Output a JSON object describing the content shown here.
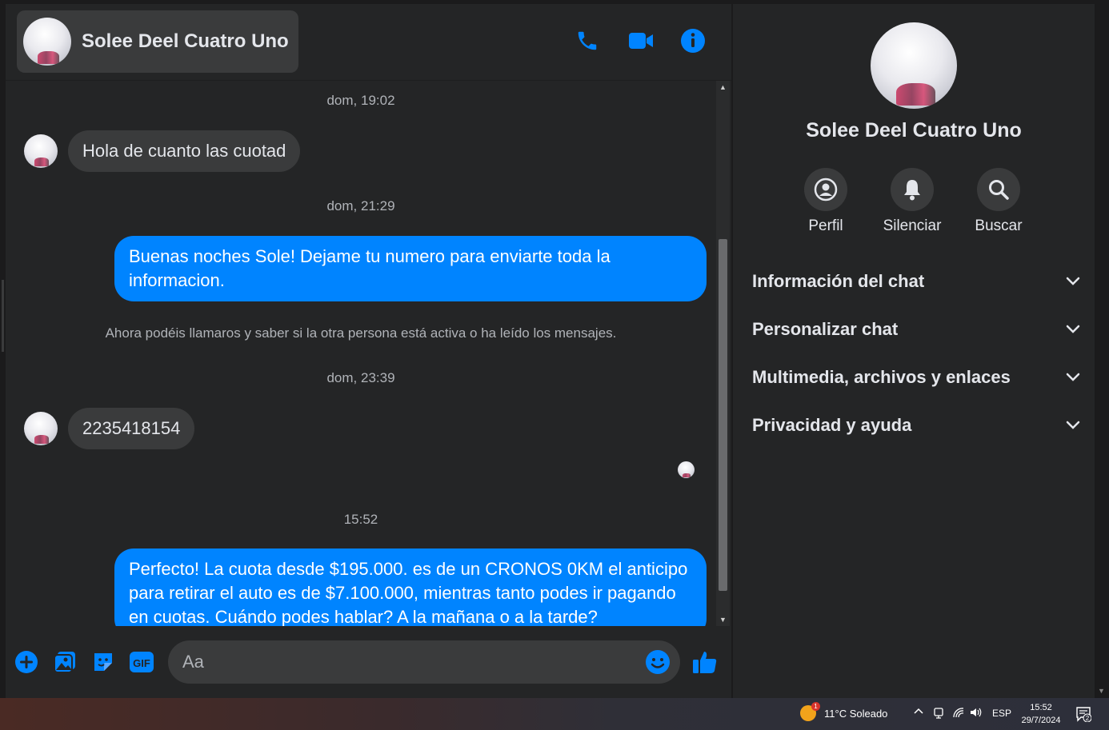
{
  "header": {
    "contact_name": "Solee Deel Cuatro Uno",
    "icons": [
      "phone-icon",
      "video-camera-icon",
      "info-icon"
    ]
  },
  "messages": {
    "ts1": "dom, 19:02",
    "msg1": "Hola de cuanto las cuotad",
    "ts2": "dom, 21:29",
    "msg2": "Buenas noches Sole! Dejame tu numero para enviarte toda la informacion.",
    "notice": "Ahora podéis llamaros y saber si la otra persona está activa o ha leído los mensajes.",
    "ts3": "dom, 23:39",
    "msg3": "2235418154",
    "ts4": "15:52",
    "msg4": "Perfecto! La cuota desde $195.000. es de un CRONOS 0KM el anticipo para retirar el auto es de $7.100.000, mientras tanto podes ir pagando en cuotas. Cuándo podes hablar? A la mañana o a la tarde?"
  },
  "composer": {
    "placeholder": "Aa",
    "icons": [
      "plus-icon",
      "image-icon",
      "sticker-icon",
      "gif-icon",
      "emoji-icon",
      "thumbs-up-icon"
    ]
  },
  "sidebar": {
    "name": "Solee Deel Cuatro Uno",
    "actions": {
      "profile": "Perfil",
      "mute": "Silenciar",
      "search": "Buscar"
    },
    "sections": {
      "info": "Información del chat",
      "customize": "Personalizar chat",
      "media": "Multimedia, archivos y enlaces",
      "privacy": "Privacidad y ayuda"
    }
  },
  "taskbar": {
    "weather": "11°C  Soleado",
    "weather_badge": "1",
    "language": "ESP",
    "time": "15:52",
    "date": "29/7/2024",
    "notifications": "2"
  },
  "colors": {
    "accent": "#0084ff",
    "background": "#242526",
    "bubble_in": "#3a3b3c",
    "text": "#e4e6eb",
    "muted": "#b0b3b8"
  }
}
